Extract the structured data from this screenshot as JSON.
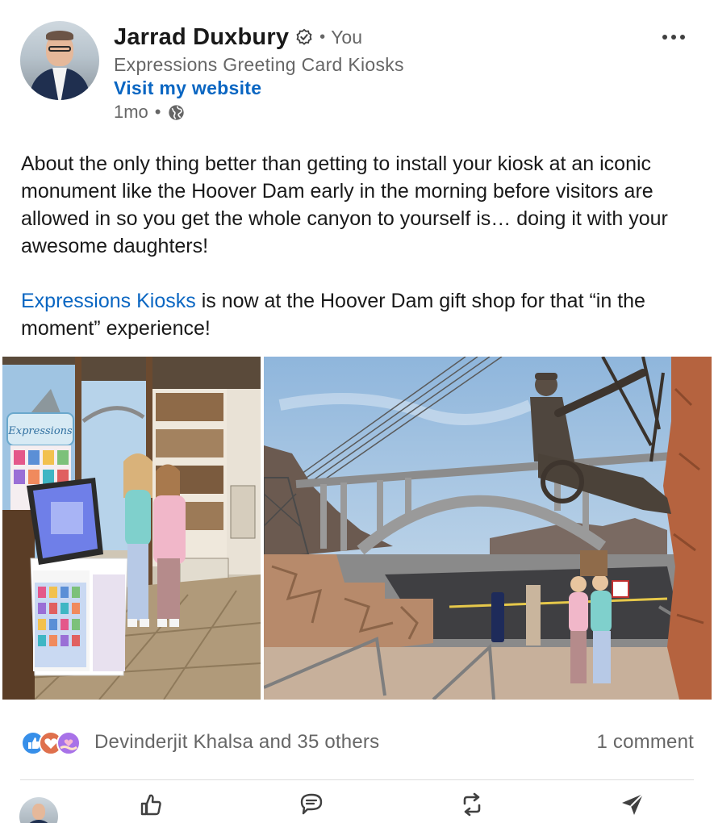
{
  "author": {
    "name": "Jarrad Duxbury",
    "relation": "You",
    "headline": "Expressions Greeting Card Kiosks",
    "website_label": "Visit my website",
    "time": "1mo",
    "visibility_icon": "globe-icon"
  },
  "menu": {
    "icon": "more-options-icon"
  },
  "post": {
    "paragraph1": "About the only thing better than getting to install your kiosk at an iconic monument like the Hoover Dam early in the morning before visitors are allowed in so you get the whole canyon to yourself is… doing it with your awesome daughters!",
    "mention": "Expressions Kiosks",
    "paragraph2_rest": " is now at the Hoover Dam gift shop for that “in the moment” experience!"
  },
  "photos": {
    "left_kiosk_sign": "Expressions"
  },
  "social": {
    "reaction_icons": [
      "like-icon",
      "love-icon",
      "support-icon"
    ],
    "reactors": "Devinderjit Khalsa and 35 others",
    "comments": "1 comment"
  },
  "actions": [
    {
      "name": "like-button",
      "icon": "thumbs-up-icon"
    },
    {
      "name": "comment-button",
      "icon": "comment-icon"
    },
    {
      "name": "repost-button",
      "icon": "repost-icon"
    },
    {
      "name": "send-button",
      "icon": "send-icon"
    }
  ],
  "colors": {
    "link": "#0a66c2",
    "text": "#191919",
    "muted": "#666666"
  }
}
